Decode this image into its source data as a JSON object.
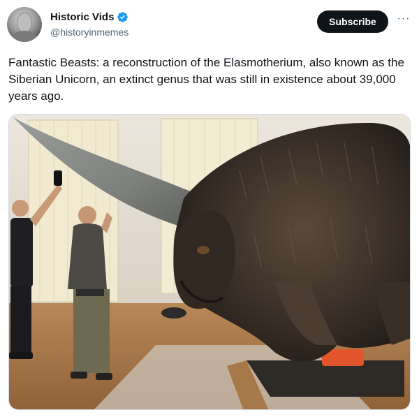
{
  "author": {
    "display_name": "Historic Vids",
    "handle": "@historyinmemes",
    "verified": true,
    "avatar_icon": "avatar-portrait-bust"
  },
  "actions": {
    "subscribe_label": "Subscribe",
    "more_icon": "more-horizontal-icon",
    "more_label": "···"
  },
  "tweet": {
    "text": "Fantastic Beasts: a reconstruction of the Elasmotherium, also known as the Siberian Unicorn, an extinct genus that was still in existence about 39,000 years ago."
  },
  "media": {
    "alt": ""
  },
  "colors": {
    "verified_blue": "#1d9bf0",
    "text_primary": "#0f1419",
    "text_secondary": "#536471",
    "button_dark": "#0f1419"
  }
}
